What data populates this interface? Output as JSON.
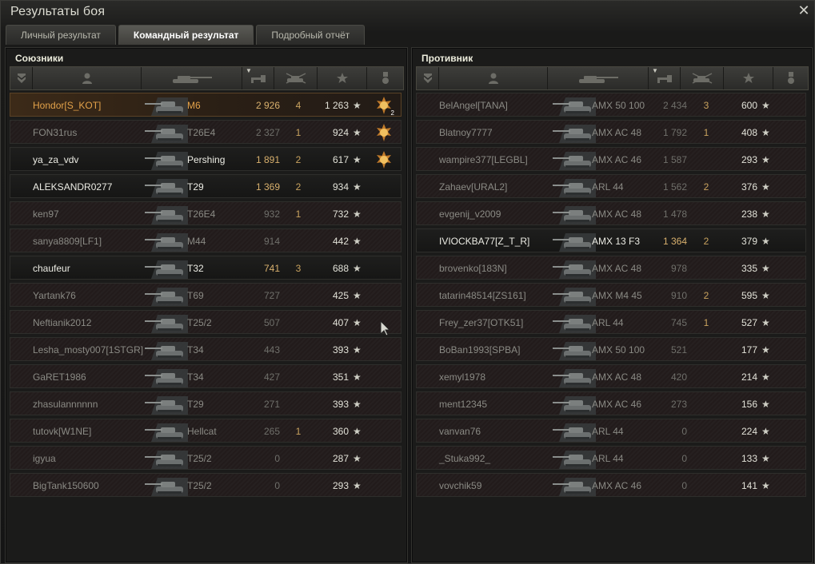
{
  "window": {
    "title": "Результаты боя",
    "close_glyph": "✕"
  },
  "tabs": [
    {
      "label": "Личный результат",
      "active": false
    },
    {
      "label": "Командный результат",
      "active": true
    },
    {
      "label": "Подробный отчёт",
      "active": false
    }
  ],
  "allies": {
    "title": "Союзники",
    "rows": [
      {
        "name": "Hondor[S_KOT]",
        "tank": "M6",
        "damage": "2 926",
        "kills": "4",
        "xp": "1 263",
        "star": "★",
        "medal": "medal-icon",
        "medal_count": "2",
        "state": "self"
      },
      {
        "name": "FON31rus",
        "tank": "T26E4",
        "damage": "2 327",
        "kills": "1",
        "xp": "924",
        "star": "★",
        "medal": "medal-icon",
        "medal_count": "",
        "state": "dead"
      },
      {
        "name": "ya_za_vdv",
        "tank": "Pershing",
        "damage": "1 891",
        "kills": "2",
        "xp": "617",
        "star": "★",
        "medal": "medal-icon",
        "medal_count": "",
        "state": "alive"
      },
      {
        "name": "ALEKSANDR0277",
        "tank": "T29",
        "damage": "1 369",
        "kills": "2",
        "xp": "934",
        "star": "★",
        "medal": "",
        "medal_count": "",
        "state": "alive"
      },
      {
        "name": "ken97",
        "tank": "T26E4",
        "damage": "932",
        "kills": "1",
        "xp": "732",
        "star": "★",
        "medal": "",
        "medal_count": "",
        "state": "dead"
      },
      {
        "name": "sanya8809[LF1]",
        "tank": "M44",
        "damage": "914",
        "kills": "",
        "xp": "442",
        "star": "★",
        "medal": "",
        "medal_count": "",
        "state": "dead"
      },
      {
        "name": "chaufeur",
        "tank": "T32",
        "damage": "741",
        "kills": "3",
        "xp": "688",
        "star": "★",
        "medal": "",
        "medal_count": "",
        "state": "alive"
      },
      {
        "name": "Yartank76",
        "tank": "T69",
        "damage": "727",
        "kills": "",
        "xp": "425",
        "star": "★",
        "medal": "",
        "medal_count": "",
        "state": "dead"
      },
      {
        "name": "Neftianik2012",
        "tank": "T25/2",
        "damage": "507",
        "kills": "",
        "xp": "407",
        "star": "★",
        "medal": "",
        "medal_count": "",
        "state": "dead"
      },
      {
        "name": "Lesha_mosty007[1STGR]",
        "tank": "T34",
        "damage": "443",
        "kills": "",
        "xp": "393",
        "star": "★",
        "medal": "",
        "medal_count": "",
        "state": "dead"
      },
      {
        "name": "GaRET1986",
        "tank": "T34",
        "damage": "427",
        "kills": "",
        "xp": "351",
        "star": "★",
        "medal": "",
        "medal_count": "",
        "state": "dead"
      },
      {
        "name": "zhasulannnnnn",
        "tank": "T29",
        "damage": "271",
        "kills": "",
        "xp": "393",
        "star": "★",
        "medal": "",
        "medal_count": "",
        "state": "dead"
      },
      {
        "name": "tutovk[W1NE]",
        "tank": "Hellcat",
        "damage": "265",
        "kills": "1",
        "xp": "360",
        "star": "★",
        "medal": "",
        "medal_count": "",
        "state": "dead"
      },
      {
        "name": "igyua",
        "tank": "T25/2",
        "damage": "0",
        "kills": "",
        "xp": "287",
        "star": "★",
        "medal": "",
        "medal_count": "",
        "state": "dead"
      },
      {
        "name": "BigTank150600",
        "tank": "T25/2",
        "damage": "0",
        "kills": "",
        "xp": "293",
        "star": "★",
        "medal": "",
        "medal_count": "",
        "state": "dead"
      }
    ]
  },
  "enemies": {
    "title": "Противник",
    "rows": [
      {
        "name": "BelAngel[TANA]",
        "tank": "AMX 50 100",
        "damage": "2 434",
        "kills": "3",
        "xp": "600",
        "star": "★",
        "state": "dead"
      },
      {
        "name": "Blatnoy7777",
        "tank": "AMX AC 48",
        "damage": "1 792",
        "kills": "1",
        "xp": "408",
        "star": "★",
        "state": "dead"
      },
      {
        "name": "wampire377[LEGBL]",
        "tank": "AMX AC 46",
        "damage": "1 587",
        "kills": "",
        "xp": "293",
        "star": "★",
        "state": "dead"
      },
      {
        "name": "Zahaev[URAL2]",
        "tank": "ARL 44",
        "damage": "1 562",
        "kills": "2",
        "xp": "376",
        "star": "★",
        "state": "dead"
      },
      {
        "name": "evgenij_v2009",
        "tank": "AMX AC 48",
        "damage": "1 478",
        "kills": "",
        "xp": "238",
        "star": "★",
        "state": "dead"
      },
      {
        "name": "IVIOCKBA77[Z_T_R]",
        "tank": "AMX 13 F3",
        "damage": "1 364",
        "kills": "2",
        "xp": "379",
        "star": "★",
        "state": "alive"
      },
      {
        "name": "brovenko[183N]",
        "tank": "AMX AC 48",
        "damage": "978",
        "kills": "",
        "xp": "335",
        "star": "★",
        "state": "dead"
      },
      {
        "name": "tatarin48514[ZS161]",
        "tank": "AMX M4 45",
        "damage": "910",
        "kills": "2",
        "xp": "595",
        "star": "★",
        "state": "dead"
      },
      {
        "name": "Frey_zer37[OTK51]",
        "tank": "ARL 44",
        "damage": "745",
        "kills": "1",
        "xp": "527",
        "star": "★",
        "state": "dead"
      },
      {
        "name": "BoBan1993[SPBA]",
        "tank": "AMX 50 100",
        "damage": "521",
        "kills": "",
        "xp": "177",
        "star": "★",
        "state": "dead"
      },
      {
        "name": "xemyl1978",
        "tank": "AMX AC 48",
        "damage": "420",
        "kills": "",
        "xp": "214",
        "star": "★",
        "state": "dead"
      },
      {
        "name": "ment12345",
        "tank": "AMX AC 46",
        "damage": "273",
        "kills": "",
        "xp": "156",
        "star": "★",
        "state": "dead"
      },
      {
        "name": "vanvan76",
        "tank": "ARL 44",
        "damage": "0",
        "kills": "",
        "xp": "224",
        "star": "★",
        "state": "dead"
      },
      {
        "name": "_Stuka992_",
        "tank": "ARL 44",
        "damage": "0",
        "kills": "",
        "xp": "133",
        "star": "★",
        "state": "dead"
      },
      {
        "name": "vovchik59",
        "tank": "AMX AC 46",
        "damage": "0",
        "kills": "",
        "xp": "141",
        "star": "★",
        "state": "dead"
      }
    ]
  },
  "header_icons": [
    "rank-icon",
    "player-icon",
    "tank-icon",
    "damage-icon",
    "kills-icon",
    "xp-star-icon",
    "medal-icon"
  ],
  "sort_glyph": "▼",
  "colors": {
    "self_name": "#e3a24a",
    "damage_alive": "#d8b06d",
    "alive_text": "#ecece4",
    "dead_text": "#8a8a84"
  }
}
